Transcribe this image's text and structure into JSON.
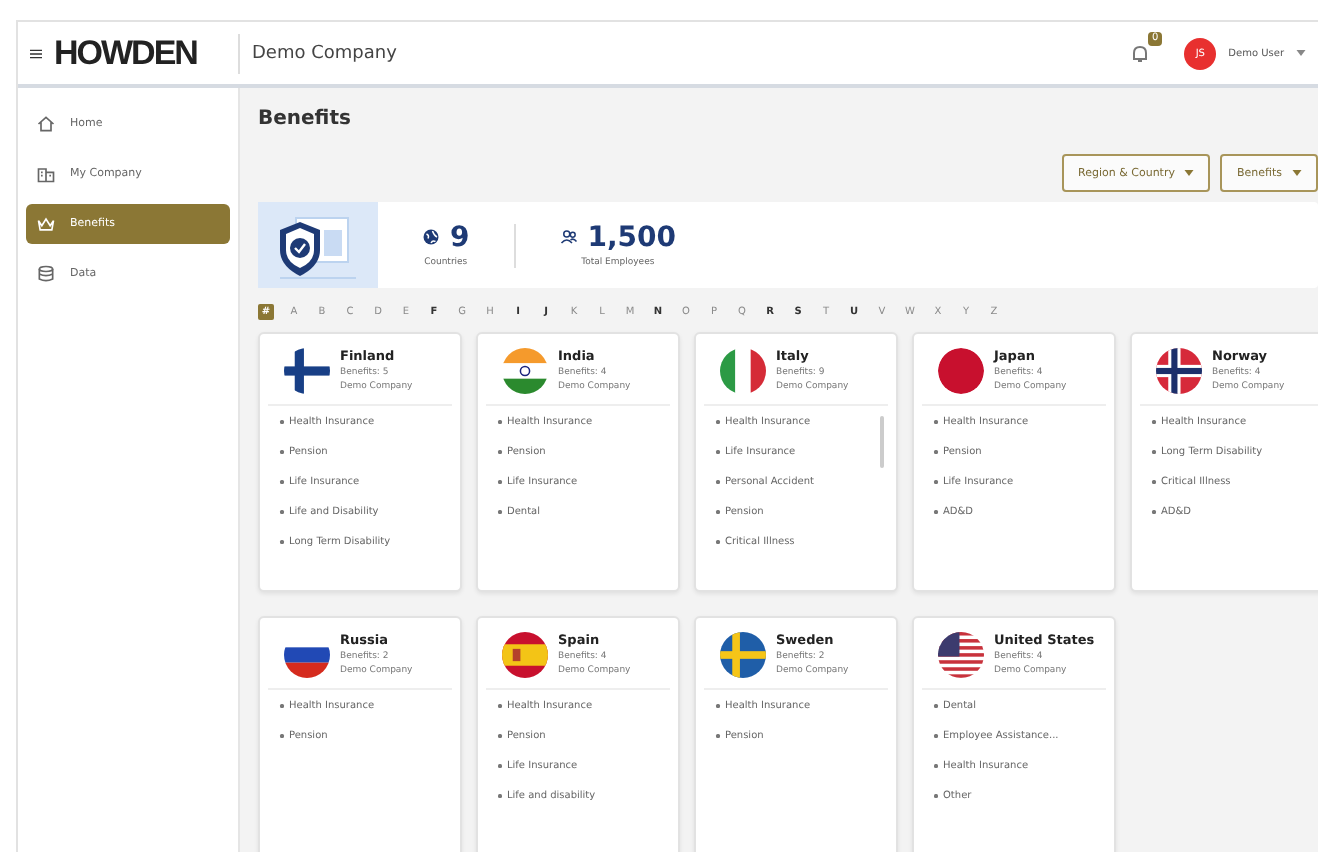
{
  "header": {
    "logo": "HOWDEN",
    "company": "Demo Company",
    "notification_count": "0",
    "user": {
      "initials": "JS",
      "name": "Demo User"
    }
  },
  "sidebar": {
    "items": [
      {
        "label": "Home",
        "kind": "home",
        "selected": false
      },
      {
        "label": "My Company",
        "kind": "building",
        "selected": false
      },
      {
        "label": "Benefits",
        "kind": "crown",
        "selected": true
      },
      {
        "label": "Data",
        "kind": "database",
        "selected": false
      }
    ]
  },
  "page": {
    "title": "Benefits",
    "filters": [
      "Region & Country",
      "Benefits"
    ]
  },
  "stats": [
    {
      "kind": "globe",
      "value": "9",
      "label": "Countries"
    },
    {
      "kind": "people",
      "value": "1,500",
      "label": "Total Employees"
    }
  ],
  "alphabet": [
    {
      "letter": "#",
      "selected": true,
      "enabled": true
    },
    {
      "letter": "A",
      "selected": false,
      "enabled": false
    },
    {
      "letter": "B",
      "selected": false,
      "enabled": false
    },
    {
      "letter": "C",
      "selected": false,
      "enabled": false
    },
    {
      "letter": "D",
      "selected": false,
      "enabled": false
    },
    {
      "letter": "E",
      "selected": false,
      "enabled": false
    },
    {
      "letter": "F",
      "selected": false,
      "enabled": true
    },
    {
      "letter": "G",
      "selected": false,
      "enabled": false
    },
    {
      "letter": "H",
      "selected": false,
      "enabled": false
    },
    {
      "letter": "I",
      "selected": false,
      "enabled": true
    },
    {
      "letter": "J",
      "selected": false,
      "enabled": true
    },
    {
      "letter": "K",
      "selected": false,
      "enabled": false
    },
    {
      "letter": "L",
      "selected": false,
      "enabled": false
    },
    {
      "letter": "M",
      "selected": false,
      "enabled": false
    },
    {
      "letter": "N",
      "selected": false,
      "enabled": true
    },
    {
      "letter": "O",
      "selected": false,
      "enabled": false
    },
    {
      "letter": "P",
      "selected": false,
      "enabled": false
    },
    {
      "letter": "Q",
      "selected": false,
      "enabled": false
    },
    {
      "letter": "R",
      "selected": false,
      "enabled": true
    },
    {
      "letter": "S",
      "selected": false,
      "enabled": true
    },
    {
      "letter": "T",
      "selected": false,
      "enabled": false
    },
    {
      "letter": "U",
      "selected": false,
      "enabled": true
    },
    {
      "letter": "V",
      "selected": false,
      "enabled": false
    },
    {
      "letter": "W",
      "selected": false,
      "enabled": false
    },
    {
      "letter": "X",
      "selected": false,
      "enabled": false
    },
    {
      "letter": "Y",
      "selected": false,
      "enabled": false
    },
    {
      "letter": "Z",
      "selected": false,
      "enabled": false
    }
  ],
  "countries": [
    {
      "name": "Finland",
      "kind": "finland",
      "count": "Benefits: 5",
      "company": "Demo Company",
      "benefits": [
        "Health Insurance",
        "Pension",
        "Life Insurance",
        "Life and Disability",
        "Long Term Disability"
      ],
      "scrollable": false
    },
    {
      "name": "India",
      "kind": "india",
      "count": "Benefits: 4",
      "company": "Demo Company",
      "benefits": [
        "Health Insurance",
        "Pension",
        "Life Insurance",
        "Dental"
      ],
      "scrollable": false
    },
    {
      "name": "Italy",
      "kind": "italy",
      "count": "Benefits: 9",
      "company": "Demo Company",
      "benefits": [
        "Health Insurance",
        "Life Insurance",
        "Personal Accident",
        "Pension",
        "Critical Illness"
      ],
      "scrollable": true
    },
    {
      "name": "Japan",
      "kind": "japan",
      "count": "Benefits: 4",
      "company": "Demo Company",
      "benefits": [
        "Health Insurance",
        "Pension",
        "Life Insurance",
        "AD&D"
      ],
      "scrollable": false
    },
    {
      "name": "Norway",
      "kind": "norway",
      "count": "Benefits: 4",
      "company": "Demo Company",
      "benefits": [
        "Health Insurance",
        "Long Term Disability",
        "Critical Illness",
        "AD&D"
      ],
      "scrollable": false
    },
    {
      "name": "Russia",
      "kind": "russia",
      "count": "Benefits: 2",
      "company": "Demo Company",
      "benefits": [
        "Health Insurance",
        "Pension"
      ],
      "scrollable": false
    },
    {
      "name": "Spain",
      "kind": "spain",
      "count": "Benefits: 4",
      "company": "Demo Company",
      "benefits": [
        "Health Insurance",
        "Pension",
        "Life Insurance",
        "Life and disability"
      ],
      "scrollable": false
    },
    {
      "name": "Sweden",
      "kind": "sweden",
      "count": "Benefits: 2",
      "company": "Demo Company",
      "benefits": [
        "Health Insurance",
        "Pension"
      ],
      "scrollable": false
    },
    {
      "name": "United States",
      "kind": "usa",
      "count": "Benefits: 4",
      "company": "Demo Company",
      "benefits": [
        "Dental",
        "Employee Assistance...",
        "Health Insurance",
        "Other"
      ],
      "scrollable": false
    }
  ]
}
